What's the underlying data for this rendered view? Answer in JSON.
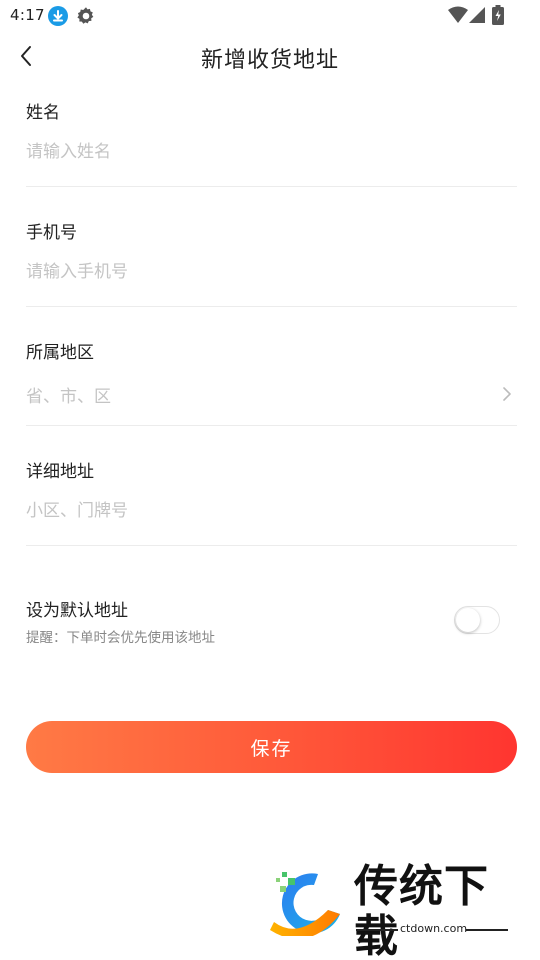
{
  "status_bar": {
    "time": "4:17"
  },
  "nav": {
    "title": "新增收货地址"
  },
  "form": {
    "name": {
      "label": "姓名",
      "placeholder": "请输入姓名",
      "value": ""
    },
    "phone": {
      "label": "手机号",
      "placeholder": "请输入手机号",
      "value": ""
    },
    "region": {
      "label": "所属地区",
      "placeholder": "省、市、区"
    },
    "detail": {
      "label": "详细地址",
      "placeholder": "小区、门牌号",
      "value": ""
    }
  },
  "default_address": {
    "title": "设为默认地址",
    "hint": "提醒：下单时会优先使用该地址",
    "enabled": false
  },
  "save_label": "保存",
  "watermark": {
    "title": "传统下载",
    "domain": "ctdown.com"
  },
  "colors": {
    "accent_start": "#ff7a45",
    "accent_end": "#ff3530",
    "placeholder": "#c4c4c4",
    "divider": "#ececec"
  },
  "icons": {
    "back": "chevron-left-icon",
    "region_arrow": "chevron-right-icon",
    "status_download": "download-icon",
    "status_settings": "gear-icon",
    "status_wifi": "wifi-icon",
    "status_signal": "signal-icon",
    "status_battery": "battery-icon"
  }
}
